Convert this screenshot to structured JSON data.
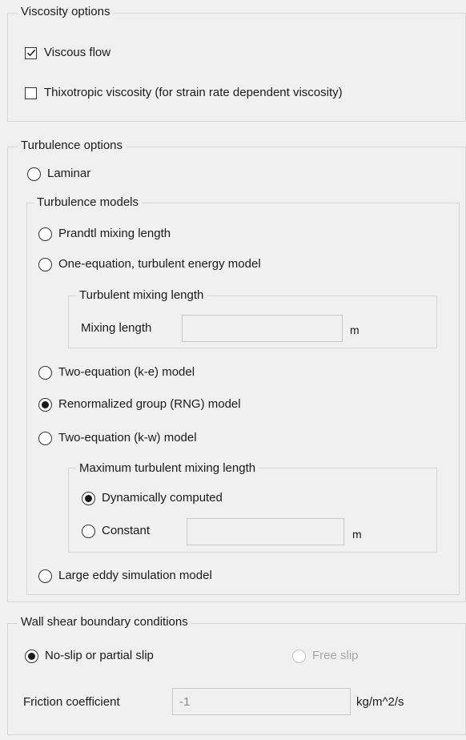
{
  "viscosity": {
    "legend": "Viscosity options",
    "viscous_flow": {
      "label": "Viscous flow",
      "checked": true
    },
    "thixotropic": {
      "label": "Thixotropic viscosity (for strain rate dependent viscosity)",
      "checked": false
    }
  },
  "turbulence": {
    "legend": "Turbulence options",
    "laminar_label": "Laminar",
    "models": {
      "legend": "Turbulence models",
      "prandtl_label": "Prandtl mixing length",
      "one_equation_label": "One-equation, turbulent energy model",
      "turbulent_mixing": {
        "legend": "Turbulent mixing length",
        "mixing_length_label": "Mixing length",
        "mixing_length_value": "",
        "unit": "m"
      },
      "k_e_label": "Two-equation (k-e) model",
      "rng_label": "Renormalized group (RNG) model",
      "k_w_label": "Two-equation (k-w) model",
      "max_mixing": {
        "legend": "Maximum turbulent mixing length",
        "dynamic_label": "Dynamically computed",
        "constant_label": "Constant",
        "constant_value": "",
        "unit": "m"
      },
      "les_label": "Large eddy simulation model",
      "selected": "rng"
    }
  },
  "wall_shear": {
    "legend": "Wall shear boundary conditions",
    "no_slip_label": "No-slip or partial slip",
    "free_slip_label": "Free slip",
    "friction_label": "Friction coefficient",
    "friction_value": "-1",
    "friction_unit": "kg/m^2/s"
  }
}
